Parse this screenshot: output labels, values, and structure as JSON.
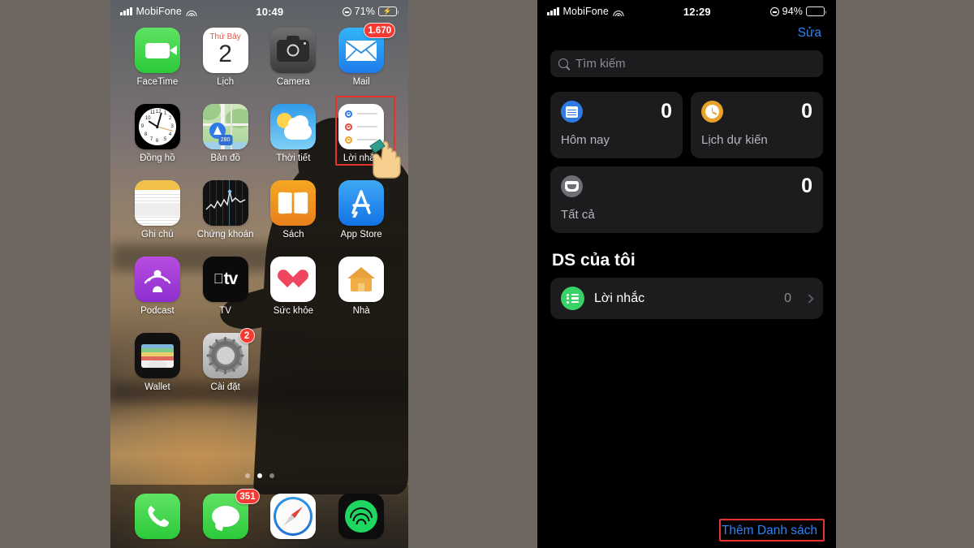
{
  "left_phone": {
    "status_bar": {
      "carrier": "MobiFone",
      "time": "10:49",
      "battery_percent": "71%",
      "battery_level": 71,
      "charging": true,
      "wifi_icon": "wifi-icon",
      "signal_icon": "signal-bars-icon",
      "lock_icon": "rotation-lock-icon"
    },
    "apps": [
      {
        "label": "FaceTime",
        "icon": "facetime-icon",
        "badge": ""
      },
      {
        "label": "Lịch",
        "icon": "calendar-icon",
        "badge": "",
        "calendar_dow": "Thứ Bảy",
        "calendar_day": "2"
      },
      {
        "label": "Camera",
        "icon": "camera-icon",
        "badge": ""
      },
      {
        "label": "Mail",
        "icon": "mail-icon",
        "badge": "1.670"
      },
      {
        "label": "Đồng hồ",
        "icon": "clock-icon",
        "badge": ""
      },
      {
        "label": "Bản đồ",
        "icon": "maps-icon",
        "badge": "",
        "shield_number": "280"
      },
      {
        "label": "Thời tiết",
        "icon": "weather-icon",
        "badge": ""
      },
      {
        "label": "Lời nhắc",
        "icon": "reminders-icon",
        "badge": ""
      },
      {
        "label": "Ghi chú",
        "icon": "notes-icon",
        "badge": ""
      },
      {
        "label": "Chứng khoán",
        "icon": "stocks-icon",
        "badge": ""
      },
      {
        "label": "Sách",
        "icon": "books-icon",
        "badge": ""
      },
      {
        "label": "App Store",
        "icon": "app-store-icon",
        "badge": ""
      },
      {
        "label": "Podcast",
        "icon": "podcasts-icon",
        "badge": ""
      },
      {
        "label": "TV",
        "icon": "apple-tv-icon",
        "badge": "",
        "wordmark": "tv"
      },
      {
        "label": "Sức khỏe",
        "icon": "health-icon",
        "badge": ""
      },
      {
        "label": "Nhà",
        "icon": "home-icon",
        "badge": ""
      },
      {
        "label": "Wallet",
        "icon": "wallet-icon",
        "badge": ""
      },
      {
        "label": "Cài đặt",
        "icon": "settings-icon",
        "badge": "2"
      }
    ],
    "page_dots": {
      "count": 3,
      "active_index": 1
    },
    "dock": [
      {
        "label": "Điện thoại",
        "icon": "phone-icon",
        "badge": ""
      },
      {
        "label": "Tin nhắn",
        "icon": "messages-icon",
        "badge": "351"
      },
      {
        "label": "Safari",
        "icon": "safari-icon",
        "badge": ""
      },
      {
        "label": "Spotify",
        "icon": "spotify-icon",
        "badge": ""
      }
    ],
    "annotations": {
      "highlight_target": "Lời nhắc",
      "highlight_color": "#e5322b",
      "cursor": "pointing-hand-cursor"
    }
  },
  "right_phone": {
    "status_bar": {
      "carrier": "MobiFone",
      "time": "12:29",
      "battery_percent": "94%",
      "battery_level": 94,
      "charging": false,
      "wifi_icon": "wifi-icon",
      "signal_icon": "signal-bars-icon",
      "lock_icon": "rotation-lock-icon"
    },
    "nav": {
      "edit_label": "Sửa"
    },
    "search": {
      "placeholder": "Tìm kiếm",
      "value": "",
      "icon": "search-icon"
    },
    "smart_lists": [
      {
        "label": "Hôm nay",
        "count": "0",
        "icon": "calendar-today-icon",
        "color": "#2f7ae5"
      },
      {
        "label": "Lịch dự kiến",
        "count": "0",
        "icon": "scheduled-clock-icon",
        "color": "#e8a12a"
      },
      {
        "label": "Tất cả",
        "count": "0",
        "icon": "all-inbox-icon",
        "color": "#6e6e73"
      }
    ],
    "my_lists": {
      "title": "DS của tôi",
      "rows": [
        {
          "name": "Lời nhắc",
          "count": "0",
          "icon": "list-bullets-icon",
          "color": "#39d267",
          "chevron": "chevron-right-icon"
        }
      ]
    },
    "add_list": {
      "label": "Thêm Danh sách",
      "color": "#2f84f5"
    },
    "annotations": {
      "highlight_target": "Thêm Danh sách",
      "highlight_color": "#e5322b",
      "cursor": "pointing-hand-cursor"
    }
  }
}
